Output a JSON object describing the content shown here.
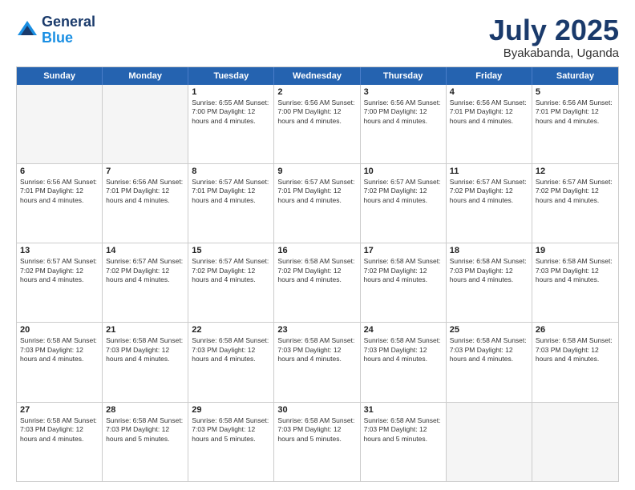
{
  "header": {
    "logo_line1": "General",
    "logo_line2": "Blue",
    "month_title": "July 2025",
    "location": "Byakabanda, Uganda"
  },
  "days_of_week": [
    "Sunday",
    "Monday",
    "Tuesday",
    "Wednesday",
    "Thursday",
    "Friday",
    "Saturday"
  ],
  "weeks": [
    [
      {
        "day": "",
        "info": ""
      },
      {
        "day": "",
        "info": ""
      },
      {
        "day": "1",
        "info": "Sunrise: 6:55 AM\nSunset: 7:00 PM\nDaylight: 12 hours\nand 4 minutes."
      },
      {
        "day": "2",
        "info": "Sunrise: 6:56 AM\nSunset: 7:00 PM\nDaylight: 12 hours\nand 4 minutes."
      },
      {
        "day": "3",
        "info": "Sunrise: 6:56 AM\nSunset: 7:00 PM\nDaylight: 12 hours\nand 4 minutes."
      },
      {
        "day": "4",
        "info": "Sunrise: 6:56 AM\nSunset: 7:01 PM\nDaylight: 12 hours\nand 4 minutes."
      },
      {
        "day": "5",
        "info": "Sunrise: 6:56 AM\nSunset: 7:01 PM\nDaylight: 12 hours\nand 4 minutes."
      }
    ],
    [
      {
        "day": "6",
        "info": "Sunrise: 6:56 AM\nSunset: 7:01 PM\nDaylight: 12 hours\nand 4 minutes."
      },
      {
        "day": "7",
        "info": "Sunrise: 6:56 AM\nSunset: 7:01 PM\nDaylight: 12 hours\nand 4 minutes."
      },
      {
        "day": "8",
        "info": "Sunrise: 6:57 AM\nSunset: 7:01 PM\nDaylight: 12 hours\nand 4 minutes."
      },
      {
        "day": "9",
        "info": "Sunrise: 6:57 AM\nSunset: 7:01 PM\nDaylight: 12 hours\nand 4 minutes."
      },
      {
        "day": "10",
        "info": "Sunrise: 6:57 AM\nSunset: 7:02 PM\nDaylight: 12 hours\nand 4 minutes."
      },
      {
        "day": "11",
        "info": "Sunrise: 6:57 AM\nSunset: 7:02 PM\nDaylight: 12 hours\nand 4 minutes."
      },
      {
        "day": "12",
        "info": "Sunrise: 6:57 AM\nSunset: 7:02 PM\nDaylight: 12 hours\nand 4 minutes."
      }
    ],
    [
      {
        "day": "13",
        "info": "Sunrise: 6:57 AM\nSunset: 7:02 PM\nDaylight: 12 hours\nand 4 minutes."
      },
      {
        "day": "14",
        "info": "Sunrise: 6:57 AM\nSunset: 7:02 PM\nDaylight: 12 hours\nand 4 minutes."
      },
      {
        "day": "15",
        "info": "Sunrise: 6:57 AM\nSunset: 7:02 PM\nDaylight: 12 hours\nand 4 minutes."
      },
      {
        "day": "16",
        "info": "Sunrise: 6:58 AM\nSunset: 7:02 PM\nDaylight: 12 hours\nand 4 minutes."
      },
      {
        "day": "17",
        "info": "Sunrise: 6:58 AM\nSunset: 7:02 PM\nDaylight: 12 hours\nand 4 minutes."
      },
      {
        "day": "18",
        "info": "Sunrise: 6:58 AM\nSunset: 7:03 PM\nDaylight: 12 hours\nand 4 minutes."
      },
      {
        "day": "19",
        "info": "Sunrise: 6:58 AM\nSunset: 7:03 PM\nDaylight: 12 hours\nand 4 minutes."
      }
    ],
    [
      {
        "day": "20",
        "info": "Sunrise: 6:58 AM\nSunset: 7:03 PM\nDaylight: 12 hours\nand 4 minutes."
      },
      {
        "day": "21",
        "info": "Sunrise: 6:58 AM\nSunset: 7:03 PM\nDaylight: 12 hours\nand 4 minutes."
      },
      {
        "day": "22",
        "info": "Sunrise: 6:58 AM\nSunset: 7:03 PM\nDaylight: 12 hours\nand 4 minutes."
      },
      {
        "day": "23",
        "info": "Sunrise: 6:58 AM\nSunset: 7:03 PM\nDaylight: 12 hours\nand 4 minutes."
      },
      {
        "day": "24",
        "info": "Sunrise: 6:58 AM\nSunset: 7:03 PM\nDaylight: 12 hours\nand 4 minutes."
      },
      {
        "day": "25",
        "info": "Sunrise: 6:58 AM\nSunset: 7:03 PM\nDaylight: 12 hours\nand 4 minutes."
      },
      {
        "day": "26",
        "info": "Sunrise: 6:58 AM\nSunset: 7:03 PM\nDaylight: 12 hours\nand 4 minutes."
      }
    ],
    [
      {
        "day": "27",
        "info": "Sunrise: 6:58 AM\nSunset: 7:03 PM\nDaylight: 12 hours\nand 4 minutes."
      },
      {
        "day": "28",
        "info": "Sunrise: 6:58 AM\nSunset: 7:03 PM\nDaylight: 12 hours\nand 5 minutes."
      },
      {
        "day": "29",
        "info": "Sunrise: 6:58 AM\nSunset: 7:03 PM\nDaylight: 12 hours\nand 5 minutes."
      },
      {
        "day": "30",
        "info": "Sunrise: 6:58 AM\nSunset: 7:03 PM\nDaylight: 12 hours\nand 5 minutes."
      },
      {
        "day": "31",
        "info": "Sunrise: 6:58 AM\nSunset: 7:03 PM\nDaylight: 12 hours\nand 5 minutes."
      },
      {
        "day": "",
        "info": ""
      },
      {
        "day": "",
        "info": ""
      }
    ]
  ]
}
